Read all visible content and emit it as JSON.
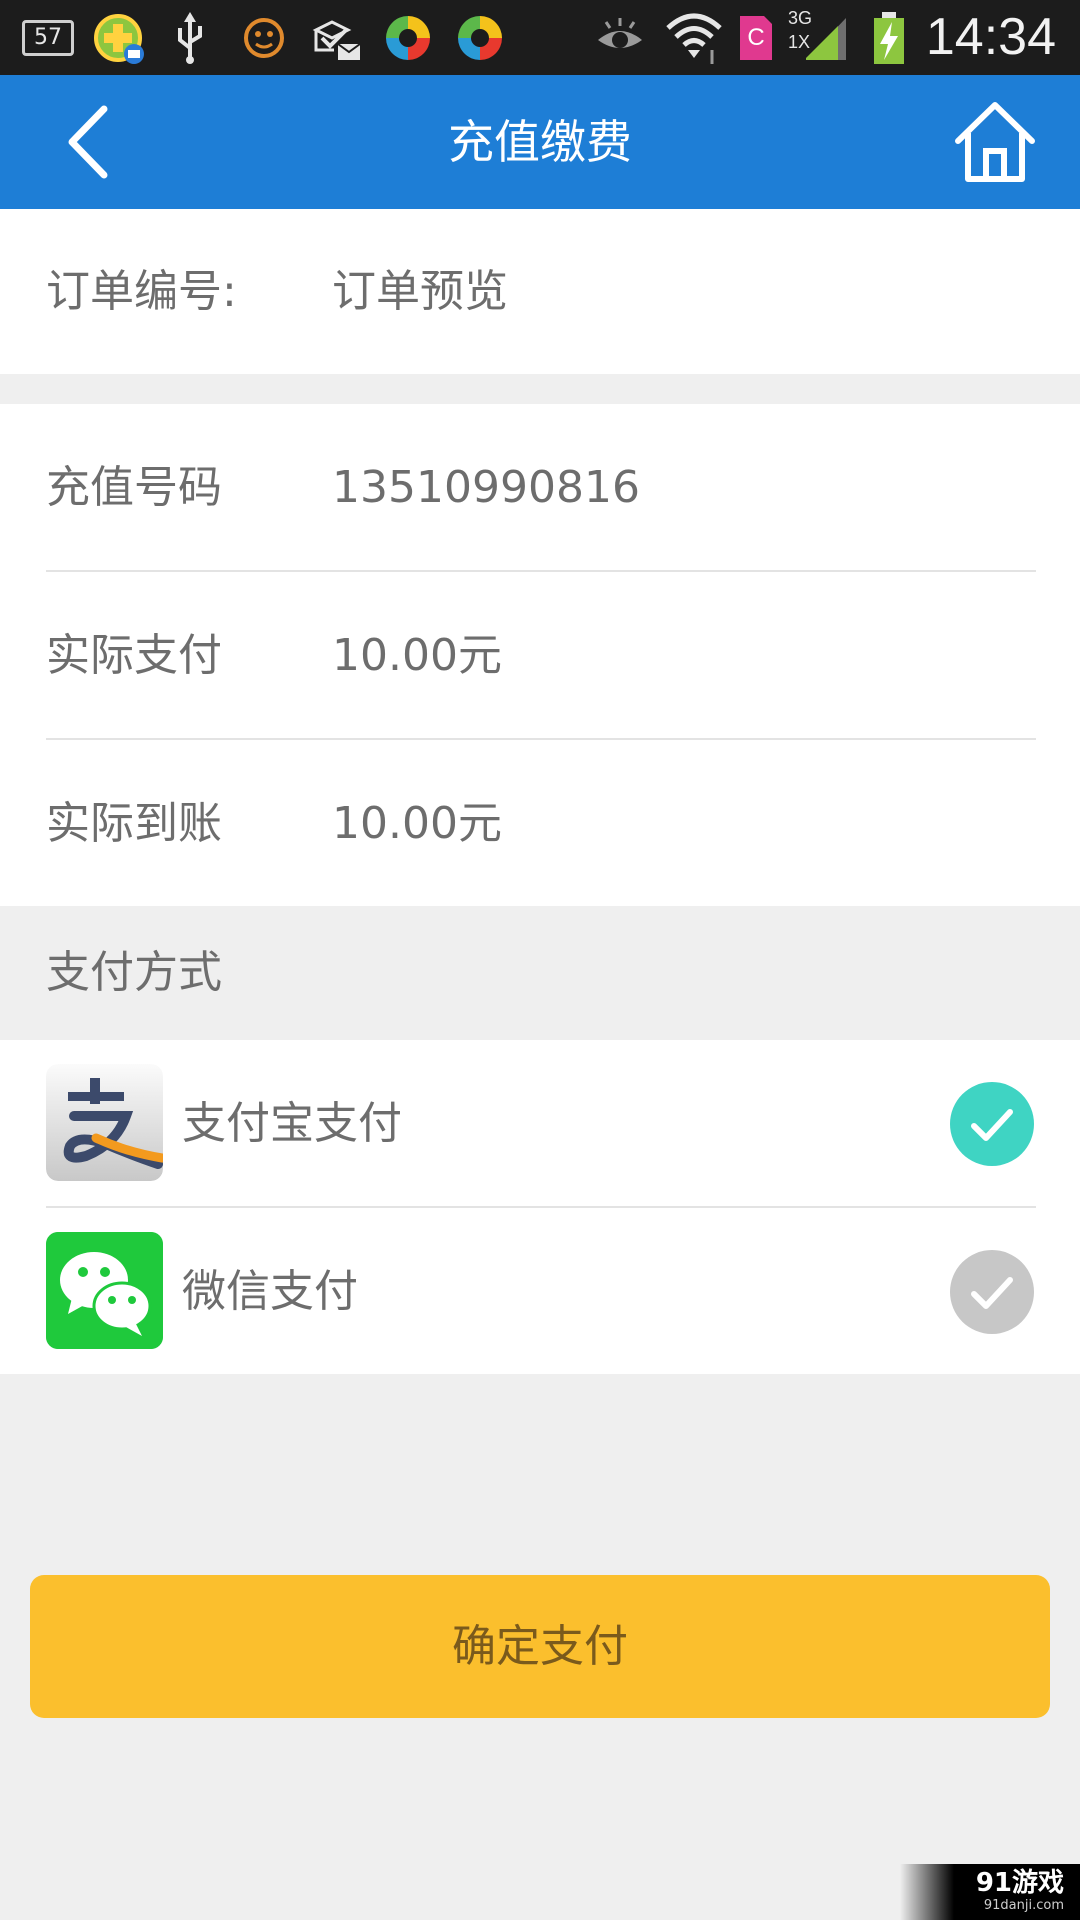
{
  "status_bar": {
    "notification_count": "57",
    "network": "3G",
    "network_sub": "1X",
    "sim_label": "C",
    "time": "14:34"
  },
  "header": {
    "title": "充值缴费"
  },
  "order": {
    "label": "订单编号:",
    "value": "订单预览"
  },
  "details": [
    {
      "label": "充值号码",
      "value": "13510990816"
    },
    {
      "label": "实际支付",
      "value": "10.00元"
    },
    {
      "label": "实际到账",
      "value": "10.00元"
    }
  ],
  "payment": {
    "header": "支付方式",
    "methods": [
      {
        "name": "支付宝支付",
        "icon": "alipay-logo",
        "selected": true
      },
      {
        "name": "微信支付",
        "icon": "wechat-logo",
        "selected": false
      }
    ]
  },
  "confirm": {
    "label": "确定支付"
  },
  "watermark": {
    "main": "91游戏",
    "sub": "91danji.com"
  },
  "colors": {
    "primary": "#1e7ed6",
    "confirm": "#fbbf2d",
    "check_on": "#3fd4c3",
    "check_off": "#c7c7c7"
  }
}
